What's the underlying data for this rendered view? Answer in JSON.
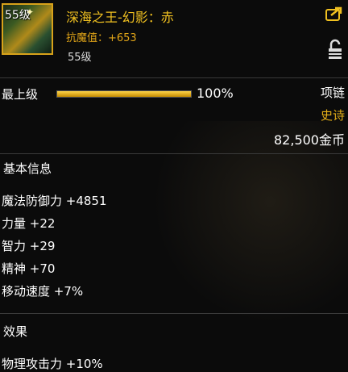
{
  "item": {
    "level_badge": "55级",
    "name": "深海之王-幻影：赤",
    "magic_resist": "抗魔值：+653",
    "level": "55级"
  },
  "grade": {
    "label": "最上级",
    "percent_text": "100%",
    "fill_fraction": 1.0
  },
  "info": {
    "slot": "项链",
    "rarity": "史诗",
    "price": "82,500金币"
  },
  "basic_section": {
    "title": "基本信息",
    "stats": [
      "魔法防御力 +4851",
      "力量 +22",
      "智力 +29",
      "精神 +70",
      "移动速度 +7%"
    ]
  },
  "effect_section": {
    "title": "效果",
    "stats": [
      "物理攻击力 +10%"
    ]
  },
  "colors": {
    "epic": "#e6b018",
    "accent": "#f0c020",
    "bar": "#ffd54a"
  },
  "icons": {
    "share": "share-icon",
    "lock": "lock-icon"
  }
}
